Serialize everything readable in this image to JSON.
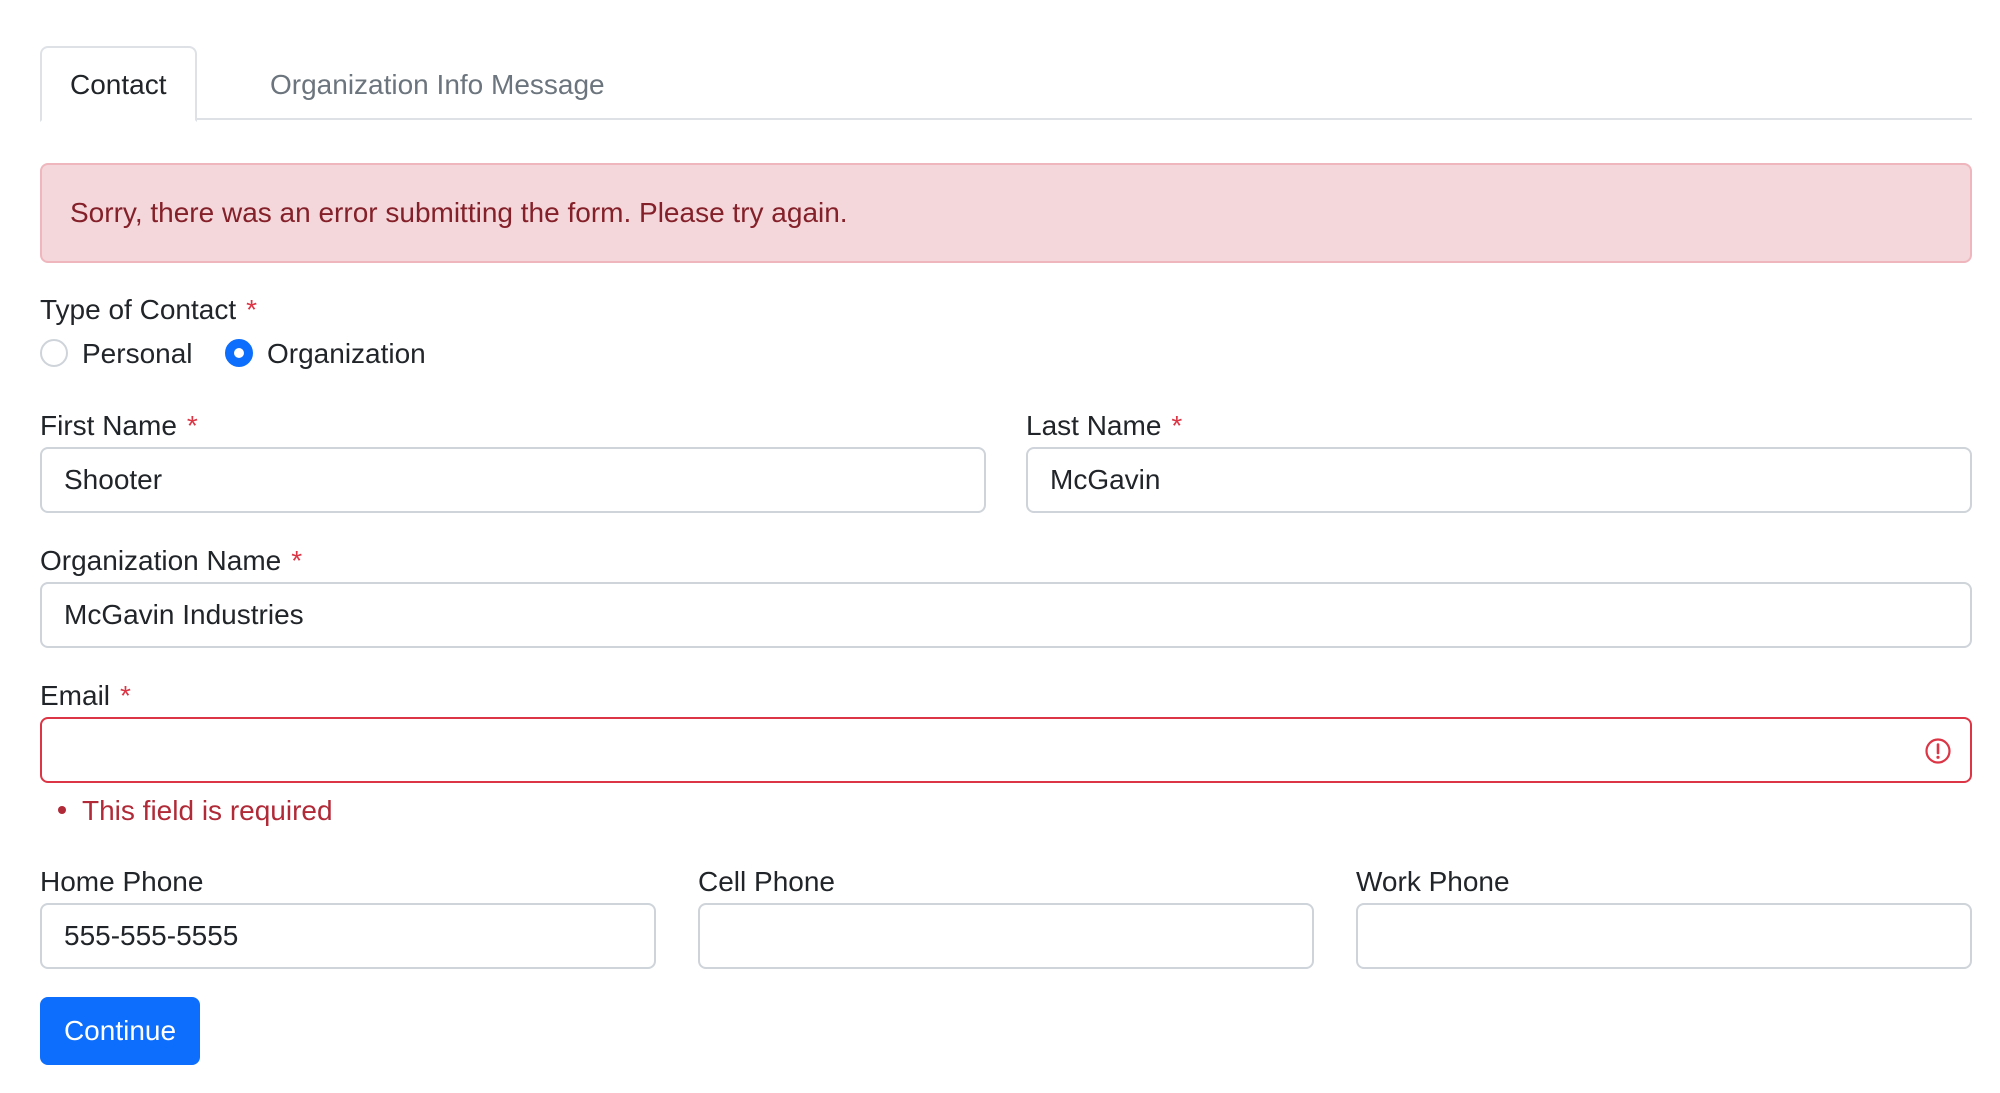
{
  "tabs": [
    {
      "label": "Contact",
      "active": true
    },
    {
      "label": "Organization Info",
      "active": false
    },
    {
      "label": "Message",
      "active": false
    }
  ],
  "alert": {
    "message": "Sorry, there was an error submitting the form. Please try again."
  },
  "required_marker": "*",
  "contact_type": {
    "label": "Type of Contact",
    "options": [
      {
        "label": "Personal",
        "checked": false
      },
      {
        "label": "Organization",
        "checked": true
      }
    ]
  },
  "first_name": {
    "label": "First Name",
    "value": "Shooter"
  },
  "last_name": {
    "label": "Last Name",
    "value": "McGavin"
  },
  "organization_name": {
    "label": "Organization Name",
    "value": "McGavin Industries"
  },
  "email": {
    "label": "Email",
    "value": "",
    "error": "This field is required",
    "error_icon": "exclamation-circle-icon"
  },
  "home_phone": {
    "label": "Home Phone",
    "value": "555-555-5555"
  },
  "cell_phone": {
    "label": "Cell Phone",
    "value": ""
  },
  "work_phone": {
    "label": "Work Phone",
    "value": ""
  },
  "continue_button": "Continue",
  "colors": {
    "primary": "#0d6efd",
    "danger": "#dc3545",
    "alert_bg": "#f3d7da",
    "alert_text": "#842029"
  }
}
